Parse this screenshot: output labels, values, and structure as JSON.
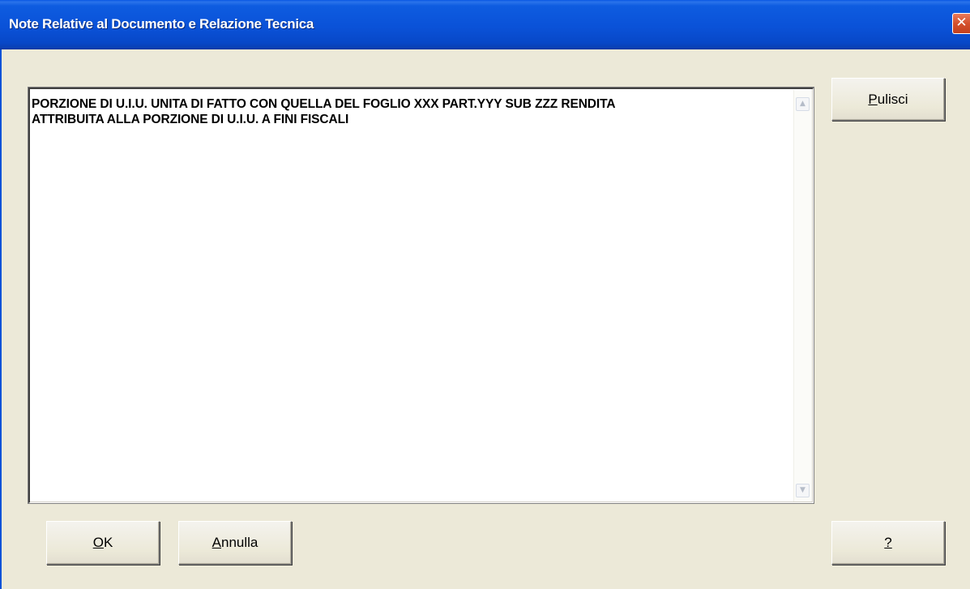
{
  "window": {
    "title": "Note Relative al Documento e Relazione Tecnica",
    "close_glyph": "✕"
  },
  "notes": {
    "text": "PORZIONE DI U.I.U. UNITA DI FATTO CON QUELLA DEL FOGLIO XXX PART.YYY SUB ZZZ RENDITA\nATTRIBUITA ALLA PORZIONE DI U.I.U. A FINI FISCALI"
  },
  "scrollbar": {
    "up_icon": "scroll-up-arrow",
    "down_icon": "scroll-down-arrow"
  },
  "buttons": {
    "pulisci": {
      "mnemonic": "P",
      "rest": "ulisci"
    },
    "ok": {
      "mnemonic": "O",
      "rest": "K"
    },
    "annulla": {
      "mnemonic": "A",
      "rest": "nnulla"
    },
    "help": {
      "mnemonic": "?",
      "rest": ""
    }
  },
  "colors": {
    "titlebar": "#0A52D8",
    "dialog_bg": "#ECE9D8",
    "close_button": "#D4502D"
  }
}
